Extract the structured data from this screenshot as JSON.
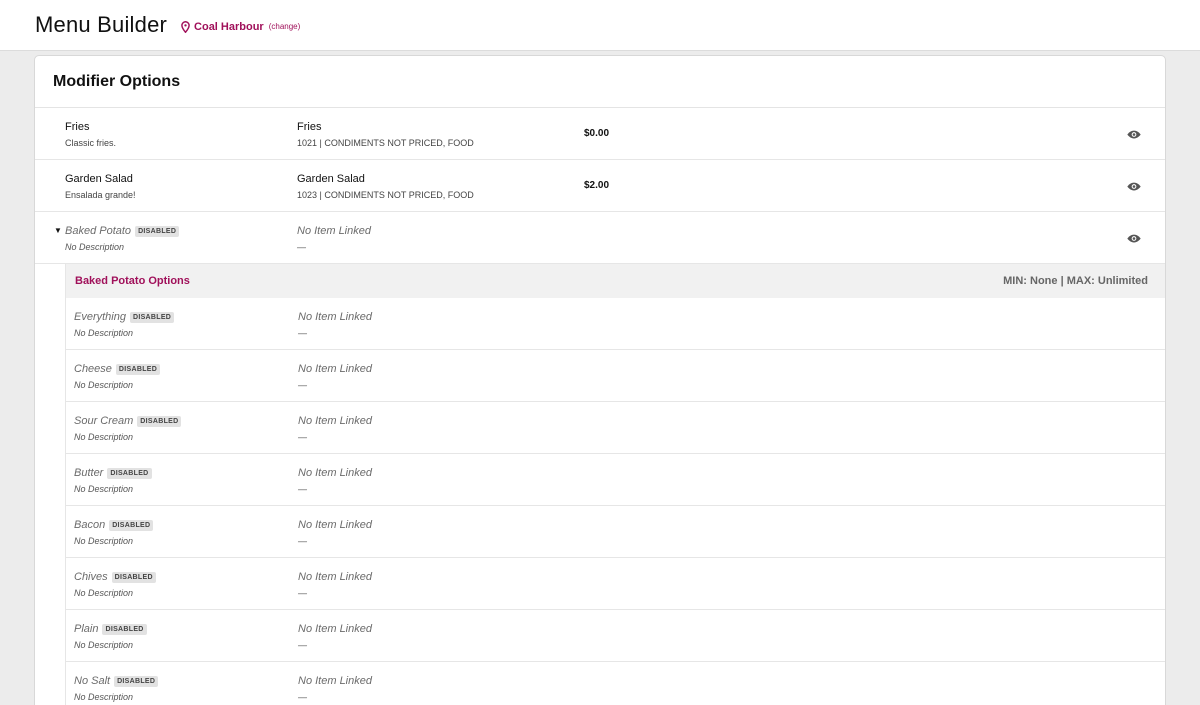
{
  "header": {
    "title": "Menu Builder",
    "location": "Coal Harbour",
    "change_label": "(change)"
  },
  "card": {
    "title": "Modifier Options"
  },
  "options": [
    {
      "name": "Fries",
      "description": "Classic fries.",
      "item_name": "Fries",
      "item_detail": "1021  |  CONDIMENTS NOT PRICED, FOOD",
      "price": "$0.00"
    },
    {
      "name": "Garden Salad",
      "description": "Ensalada grande!",
      "item_name": "Garden Salad",
      "item_detail": "1023  |  CONDIMENTS NOT PRICED, FOOD",
      "price": "$2.00"
    },
    {
      "name": "Baked Potato",
      "description": "No Description",
      "badge": "DISABLED",
      "item_name": "No Item Linked",
      "item_detail": "—"
    }
  ],
  "subgroup": {
    "title": "Baked Potato Options",
    "minmax": "MIN: None | MAX: Unlimited",
    "items": [
      {
        "name": "Everything",
        "description": "No Description",
        "badge": "DISABLED",
        "item_name": "No Item Linked",
        "item_detail": "—"
      },
      {
        "name": "Cheese",
        "description": "No Description",
        "badge": "DISABLED",
        "item_name": "No Item Linked",
        "item_detail": "—"
      },
      {
        "name": "Sour Cream",
        "description": "No Description",
        "badge": "DISABLED",
        "item_name": "No Item Linked",
        "item_detail": "—"
      },
      {
        "name": "Butter",
        "description": "No Description",
        "badge": "DISABLED",
        "item_name": "No Item Linked",
        "item_detail": "—"
      },
      {
        "name": "Bacon",
        "description": "No Description",
        "badge": "DISABLED",
        "item_name": "No Item Linked",
        "item_detail": "—"
      },
      {
        "name": "Chives",
        "description": "No Description",
        "badge": "DISABLED",
        "item_name": "No Item Linked",
        "item_detail": "—"
      },
      {
        "name": "Plain",
        "description": "No Description",
        "badge": "DISABLED",
        "item_name": "No Item Linked",
        "item_detail": "—"
      },
      {
        "name": "No Salt",
        "description": "No Description",
        "badge": "DISABLED",
        "item_name": "No Item Linked",
        "item_detail": "—"
      }
    ]
  },
  "colors": {
    "accent": "#a0105a",
    "background": "#ececec",
    "badge_bg": "#e2e2e2"
  }
}
